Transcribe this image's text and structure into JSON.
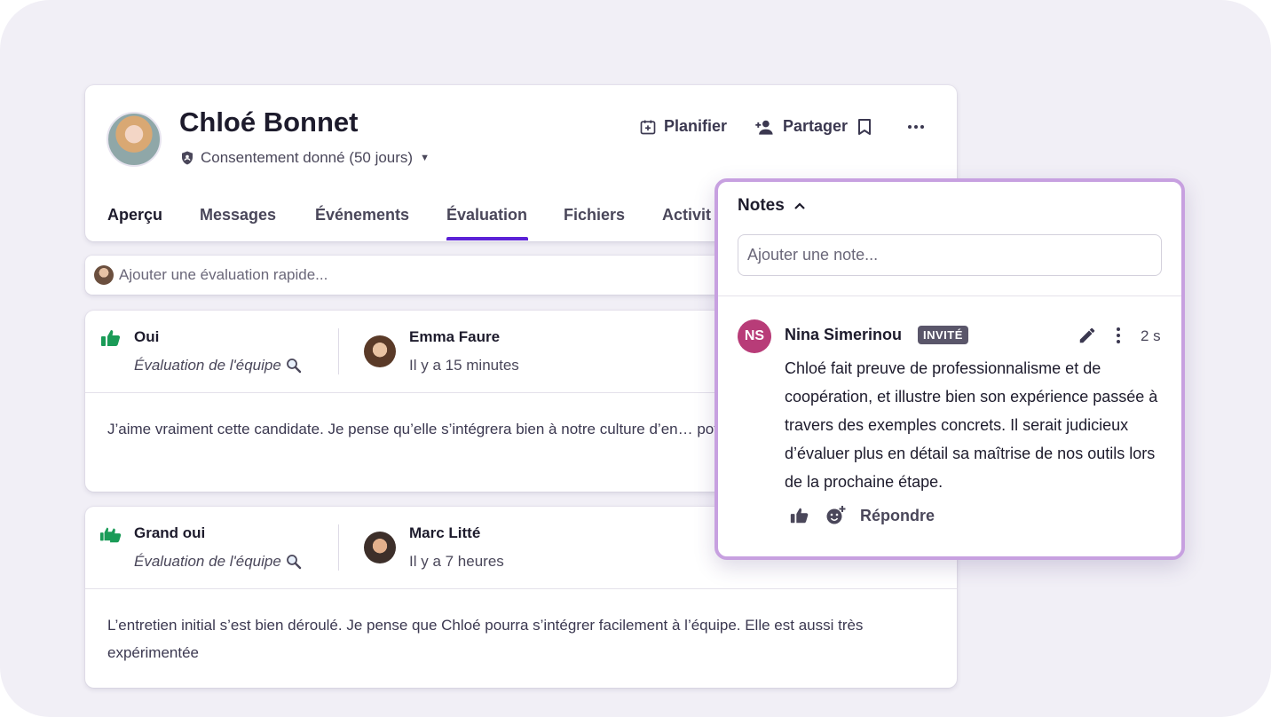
{
  "candidate": {
    "name": "Chloé Bonnet",
    "consent": "Consentement donné (50 jours)"
  },
  "header_actions": {
    "schedule": "Planifier",
    "share": "Partager"
  },
  "tabs": [
    {
      "label": "Aperçu"
    },
    {
      "label": "Messages"
    },
    {
      "label": "Événements"
    },
    {
      "label": "Évaluation"
    },
    {
      "label": "Fichiers"
    },
    {
      "label": "Activit"
    }
  ],
  "active_tab": "Évaluation",
  "quick_eval": {
    "placeholder": "Ajouter une évaluation rapide..."
  },
  "evaluations": [
    {
      "verdict": "Oui",
      "team": "Évaluation de l'équipe",
      "reviewer": "Emma Faure",
      "time": "Il y a 15 minutes",
      "body": "J’aime vraiment cette candidate. Je pense qu’elle s’intégrera bien à notre culture d’en… potentiel."
    },
    {
      "verdict": "Grand oui",
      "team": "Évaluation de l'équipe",
      "reviewer": "Marc Litté",
      "time": "Il y a 7 heures",
      "body": "L’entretien initial s’est bien déroulé. Je pense que Chloé pourra s’intégrer facilement à l’équipe. Elle est aussi très expérimentée"
    }
  ],
  "notes": {
    "title": "Notes",
    "placeholder": "Ajouter une note...",
    "items": [
      {
        "initials": "NS",
        "author": "Nina Simerinou",
        "badge": "INVITÉ",
        "time": "2 s",
        "text": "Chloé fait preuve de professionnalisme et de coopération, et illustre bien son expérience passée à travers des exemples concrets. Il serait judicieux d’évaluer plus en détail sa maîtrise de nos outils lors de la prochaine étape.",
        "reply": "Répondre"
      }
    ]
  },
  "colors": {
    "accent": "#5b21d6",
    "positive": "#1a9b57",
    "panel_border": "#c7a0e0",
    "author_avatar": "#b83c78",
    "background": "#f1eff6"
  },
  "icons": [
    "shield-icon",
    "calendar-plus-icon",
    "person-add-icon",
    "bookmark-icon",
    "more-horizontal-icon",
    "chevron-up-icon",
    "thumbs-up-icon",
    "double-thumbs-up-icon",
    "search-icon",
    "edit-icon",
    "more-vertical-icon",
    "add-reaction-icon"
  ]
}
